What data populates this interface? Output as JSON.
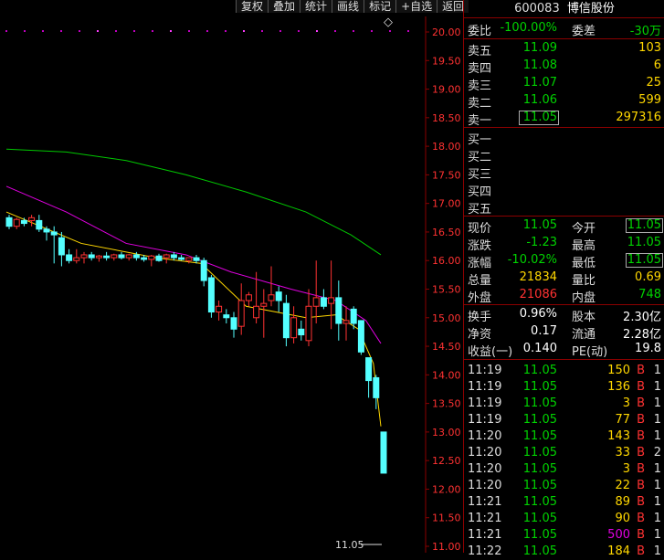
{
  "toolbar": [
    "复权",
    "叠加",
    "统计",
    "画线",
    "标记",
    "+自选",
    "返回"
  ],
  "diamond": "◇",
  "header": {
    "code": "600083",
    "name": "博信股份"
  },
  "weibi": {
    "label": "委比",
    "value": "-100.00%",
    "diff_label": "委差",
    "diff_value": "-30万"
  },
  "sell": [
    {
      "label": "卖五",
      "price": "11.09",
      "vol": "103"
    },
    {
      "label": "卖四",
      "price": "11.08",
      "vol": "6"
    },
    {
      "label": "卖三",
      "price": "11.07",
      "vol": "25"
    },
    {
      "label": "卖二",
      "price": "11.06",
      "vol": "599"
    },
    {
      "label": "卖一",
      "price": "11.05",
      "vol": "297316"
    }
  ],
  "buy": [
    {
      "label": "买一"
    },
    {
      "label": "买二"
    },
    {
      "label": "买三"
    },
    {
      "label": "买四"
    },
    {
      "label": "买五"
    }
  ],
  "quote": [
    {
      "l1": "现价",
      "v1": "11.05",
      "l2": "今开",
      "v2": "11.05"
    },
    {
      "l1": "涨跌",
      "v1": "-1.23",
      "l2": "最高",
      "v2": "11.05"
    },
    {
      "l1": "涨幅",
      "v1": "-10.02%",
      "l2": "最低",
      "v2": "11.05"
    }
  ],
  "volume": [
    {
      "l1": "总量",
      "v1": "21834",
      "l2": "量比",
      "v2": "0.69"
    },
    {
      "l1": "外盘",
      "v1": "21086",
      "l2": "内盘",
      "v2": "748"
    }
  ],
  "stats": [
    {
      "l1": "换手",
      "v1": "0.96%",
      "l2": "股本",
      "v2": "2.30亿"
    },
    {
      "l1": "净资",
      "v1": "0.17",
      "l2": "流通",
      "v2": "2.28亿"
    },
    {
      "l1": "收益(一)",
      "v1": "0.140",
      "l2": "PE(动)",
      "v2": "19.8"
    }
  ],
  "ticks": [
    {
      "time": "11:19",
      "price": "11.05",
      "vol": "150",
      "side": "B",
      "n": "1"
    },
    {
      "time": "11:19",
      "price": "11.05",
      "vol": "136",
      "side": "B",
      "n": "1"
    },
    {
      "time": "11:19",
      "price": "11.05",
      "vol": "3",
      "side": "B",
      "n": "1"
    },
    {
      "time": "11:19",
      "price": "11.05",
      "vol": "77",
      "side": "B",
      "n": "1"
    },
    {
      "time": "11:20",
      "price": "11.05",
      "vol": "143",
      "side": "B",
      "n": "1"
    },
    {
      "time": "11:20",
      "price": "11.05",
      "vol": "33",
      "side": "B",
      "n": "2"
    },
    {
      "time": "11:20",
      "price": "11.05",
      "vol": "3",
      "side": "B",
      "n": "1"
    },
    {
      "time": "11:20",
      "price": "11.05",
      "vol": "22",
      "side": "B",
      "n": "1"
    },
    {
      "time": "11:21",
      "price": "11.05",
      "vol": "89",
      "side": "B",
      "n": "1"
    },
    {
      "time": "11:21",
      "price": "11.05",
      "vol": "90",
      "side": "B",
      "n": "1"
    },
    {
      "time": "11:21",
      "price": "11.05",
      "vol": "500",
      "side": "B",
      "n": "1",
      "purple": true
    },
    {
      "time": "11:22",
      "price": "11.05",
      "vol": "184",
      "side": "B",
      "n": "1"
    }
  ],
  "chart_data": {
    "type": "candlestick",
    "y_ticks": [
      "20.00",
      "19.50",
      "19.00",
      "18.50",
      "18.00",
      "17.50",
      "17.00",
      "16.50",
      "16.00",
      "15.50",
      "15.00",
      "14.50",
      "14.00",
      "13.50",
      "13.00",
      "12.50",
      "12.00",
      "11.50",
      "11.00"
    ],
    "ylim": [
      11.0,
      20.25
    ],
    "last_label": "11.05",
    "candles": [
      {
        "o": 16.75,
        "h": 16.8,
        "l": 16.55,
        "c": 16.6
      },
      {
        "o": 16.6,
        "h": 16.75,
        "l": 16.55,
        "c": 16.72
      },
      {
        "o": 16.7,
        "h": 16.75,
        "l": 16.6,
        "c": 16.65
      },
      {
        "o": 16.7,
        "h": 16.8,
        "l": 16.6,
        "c": 16.75
      },
      {
        "o": 16.7,
        "h": 16.8,
        "l": 16.5,
        "c": 16.55
      },
      {
        "o": 16.55,
        "h": 16.6,
        "l": 16.35,
        "c": 16.5
      },
      {
        "o": 16.5,
        "h": 16.6,
        "l": 15.95,
        "c": 16.45
      },
      {
        "o": 16.4,
        "h": 16.5,
        "l": 15.9,
        "c": 16.1
      },
      {
        "o": 16.1,
        "h": 16.2,
        "l": 15.95,
        "c": 16.0
      },
      {
        "o": 16.0,
        "h": 16.2,
        "l": 15.95,
        "c": 16.05
      },
      {
        "o": 16.05,
        "h": 16.15,
        "l": 15.95,
        "c": 16.1
      },
      {
        "o": 16.1,
        "h": 16.15,
        "l": 16.0,
        "c": 16.05
      },
      {
        "o": 16.05,
        "h": 16.1,
        "l": 15.98,
        "c": 16.08
      },
      {
        "o": 16.08,
        "h": 16.15,
        "l": 16.0,
        "c": 16.05
      },
      {
        "o": 16.05,
        "h": 16.12,
        "l": 16.0,
        "c": 16.1
      },
      {
        "o": 16.1,
        "h": 16.15,
        "l": 16.02,
        "c": 16.05
      },
      {
        "o": 16.05,
        "h": 16.12,
        "l": 16.0,
        "c": 16.1
      },
      {
        "o": 16.1,
        "h": 16.15,
        "l": 16.0,
        "c": 16.05
      },
      {
        "o": 16.05,
        "h": 16.1,
        "l": 15.98,
        "c": 16.02
      },
      {
        "o": 16.02,
        "h": 16.1,
        "l": 15.9,
        "c": 16.08
      },
      {
        "o": 16.08,
        "h": 16.12,
        "l": 15.98,
        "c": 16.0
      },
      {
        "o": 16.05,
        "h": 16.12,
        "l": 15.95,
        "c": 16.1
      },
      {
        "o": 16.1,
        "h": 16.15,
        "l": 16.0,
        "c": 16.05
      },
      {
        "o": 16.05,
        "h": 16.1,
        "l": 16.0,
        "c": 16.02
      },
      {
        "o": 16.0,
        "h": 16.05,
        "l": 15.95,
        "c": 16.05
      },
      {
        "o": 16.05,
        "h": 16.1,
        "l": 15.95,
        "c": 16.0
      },
      {
        "o": 16.0,
        "h": 16.05,
        "l": 15.55,
        "c": 15.65
      },
      {
        "o": 15.7,
        "h": 15.75,
        "l": 15.0,
        "c": 15.1
      },
      {
        "o": 15.1,
        "h": 15.3,
        "l": 14.95,
        "c": 15.2
      },
      {
        "o": 15.05,
        "h": 15.15,
        "l": 14.9,
        "c": 15.0
      },
      {
        "o": 15.0,
        "h": 15.1,
        "l": 14.65,
        "c": 14.8
      },
      {
        "o": 14.85,
        "h": 15.6,
        "l": 14.7,
        "c": 15.3
      },
      {
        "o": 15.3,
        "h": 15.45,
        "l": 15.2,
        "c": 15.4
      },
      {
        "o": 15.0,
        "h": 15.8,
        "l": 14.9,
        "c": 15.2
      },
      {
        "o": 15.2,
        "h": 15.5,
        "l": 14.65,
        "c": 15.25
      },
      {
        "o": 15.3,
        "h": 15.9,
        "l": 15.2,
        "c": 15.4
      },
      {
        "o": 15.45,
        "h": 15.55,
        "l": 15.1,
        "c": 15.3
      },
      {
        "o": 15.25,
        "h": 15.4,
        "l": 14.5,
        "c": 14.65
      },
      {
        "o": 14.65,
        "h": 15.2,
        "l": 14.55,
        "c": 15.0
      },
      {
        "o": 14.8,
        "h": 14.95,
        "l": 14.6,
        "c": 14.7
      },
      {
        "o": 14.6,
        "h": 15.5,
        "l": 14.5,
        "c": 15.2
      },
      {
        "o": 15.2,
        "h": 16.0,
        "l": 14.9,
        "c": 15.35
      },
      {
        "o": 15.35,
        "h": 15.5,
        "l": 15.15,
        "c": 15.2
      },
      {
        "o": 15.25,
        "h": 16.0,
        "l": 14.8,
        "c": 15.35
      },
      {
        "o": 15.35,
        "h": 15.65,
        "l": 14.6,
        "c": 14.9
      },
      {
        "o": 14.9,
        "h": 15.2,
        "l": 14.6,
        "c": 14.95
      },
      {
        "o": 15.15,
        "h": 15.2,
        "l": 14.8,
        "c": 14.9
      },
      {
        "o": 14.95,
        "h": 14.95,
        "l": 14.35,
        "c": 14.4
      },
      {
        "o": 14.3,
        "h": 14.3,
        "l": 13.6,
        "c": 13.9
      },
      {
        "o": 13.95,
        "h": 14.0,
        "l": 13.4,
        "c": 13.6
      },
      {
        "o": 13.0,
        "h": 13.0,
        "l": 12.28,
        "c": 12.28
      }
    ],
    "ma_lines": [
      {
        "color": "#ffd700",
        "points": [
          [
            0,
            16.85
          ],
          [
            10,
            16.3
          ],
          [
            20,
            16.05
          ],
          [
            26,
            15.95
          ],
          [
            32,
            15.2
          ],
          [
            40,
            15.0
          ],
          [
            44,
            15.05
          ],
          [
            47,
            14.8
          ],
          [
            49,
            14.2
          ],
          [
            50,
            13.1
          ]
        ]
      },
      {
        "color": "#e000e0",
        "points": [
          [
            0,
            17.3
          ],
          [
            8,
            16.85
          ],
          [
            16,
            16.3
          ],
          [
            24,
            16.1
          ],
          [
            30,
            15.8
          ],
          [
            38,
            15.5
          ],
          [
            44,
            15.3
          ],
          [
            48,
            14.95
          ],
          [
            50,
            14.55
          ]
        ]
      },
      {
        "color": "#00c800",
        "points": [
          [
            0,
            17.95
          ],
          [
            8,
            17.9
          ],
          [
            16,
            17.75
          ],
          [
            24,
            17.5
          ],
          [
            32,
            17.2
          ],
          [
            40,
            16.85
          ],
          [
            46,
            16.45
          ],
          [
            50,
            16.1
          ]
        ]
      }
    ]
  }
}
